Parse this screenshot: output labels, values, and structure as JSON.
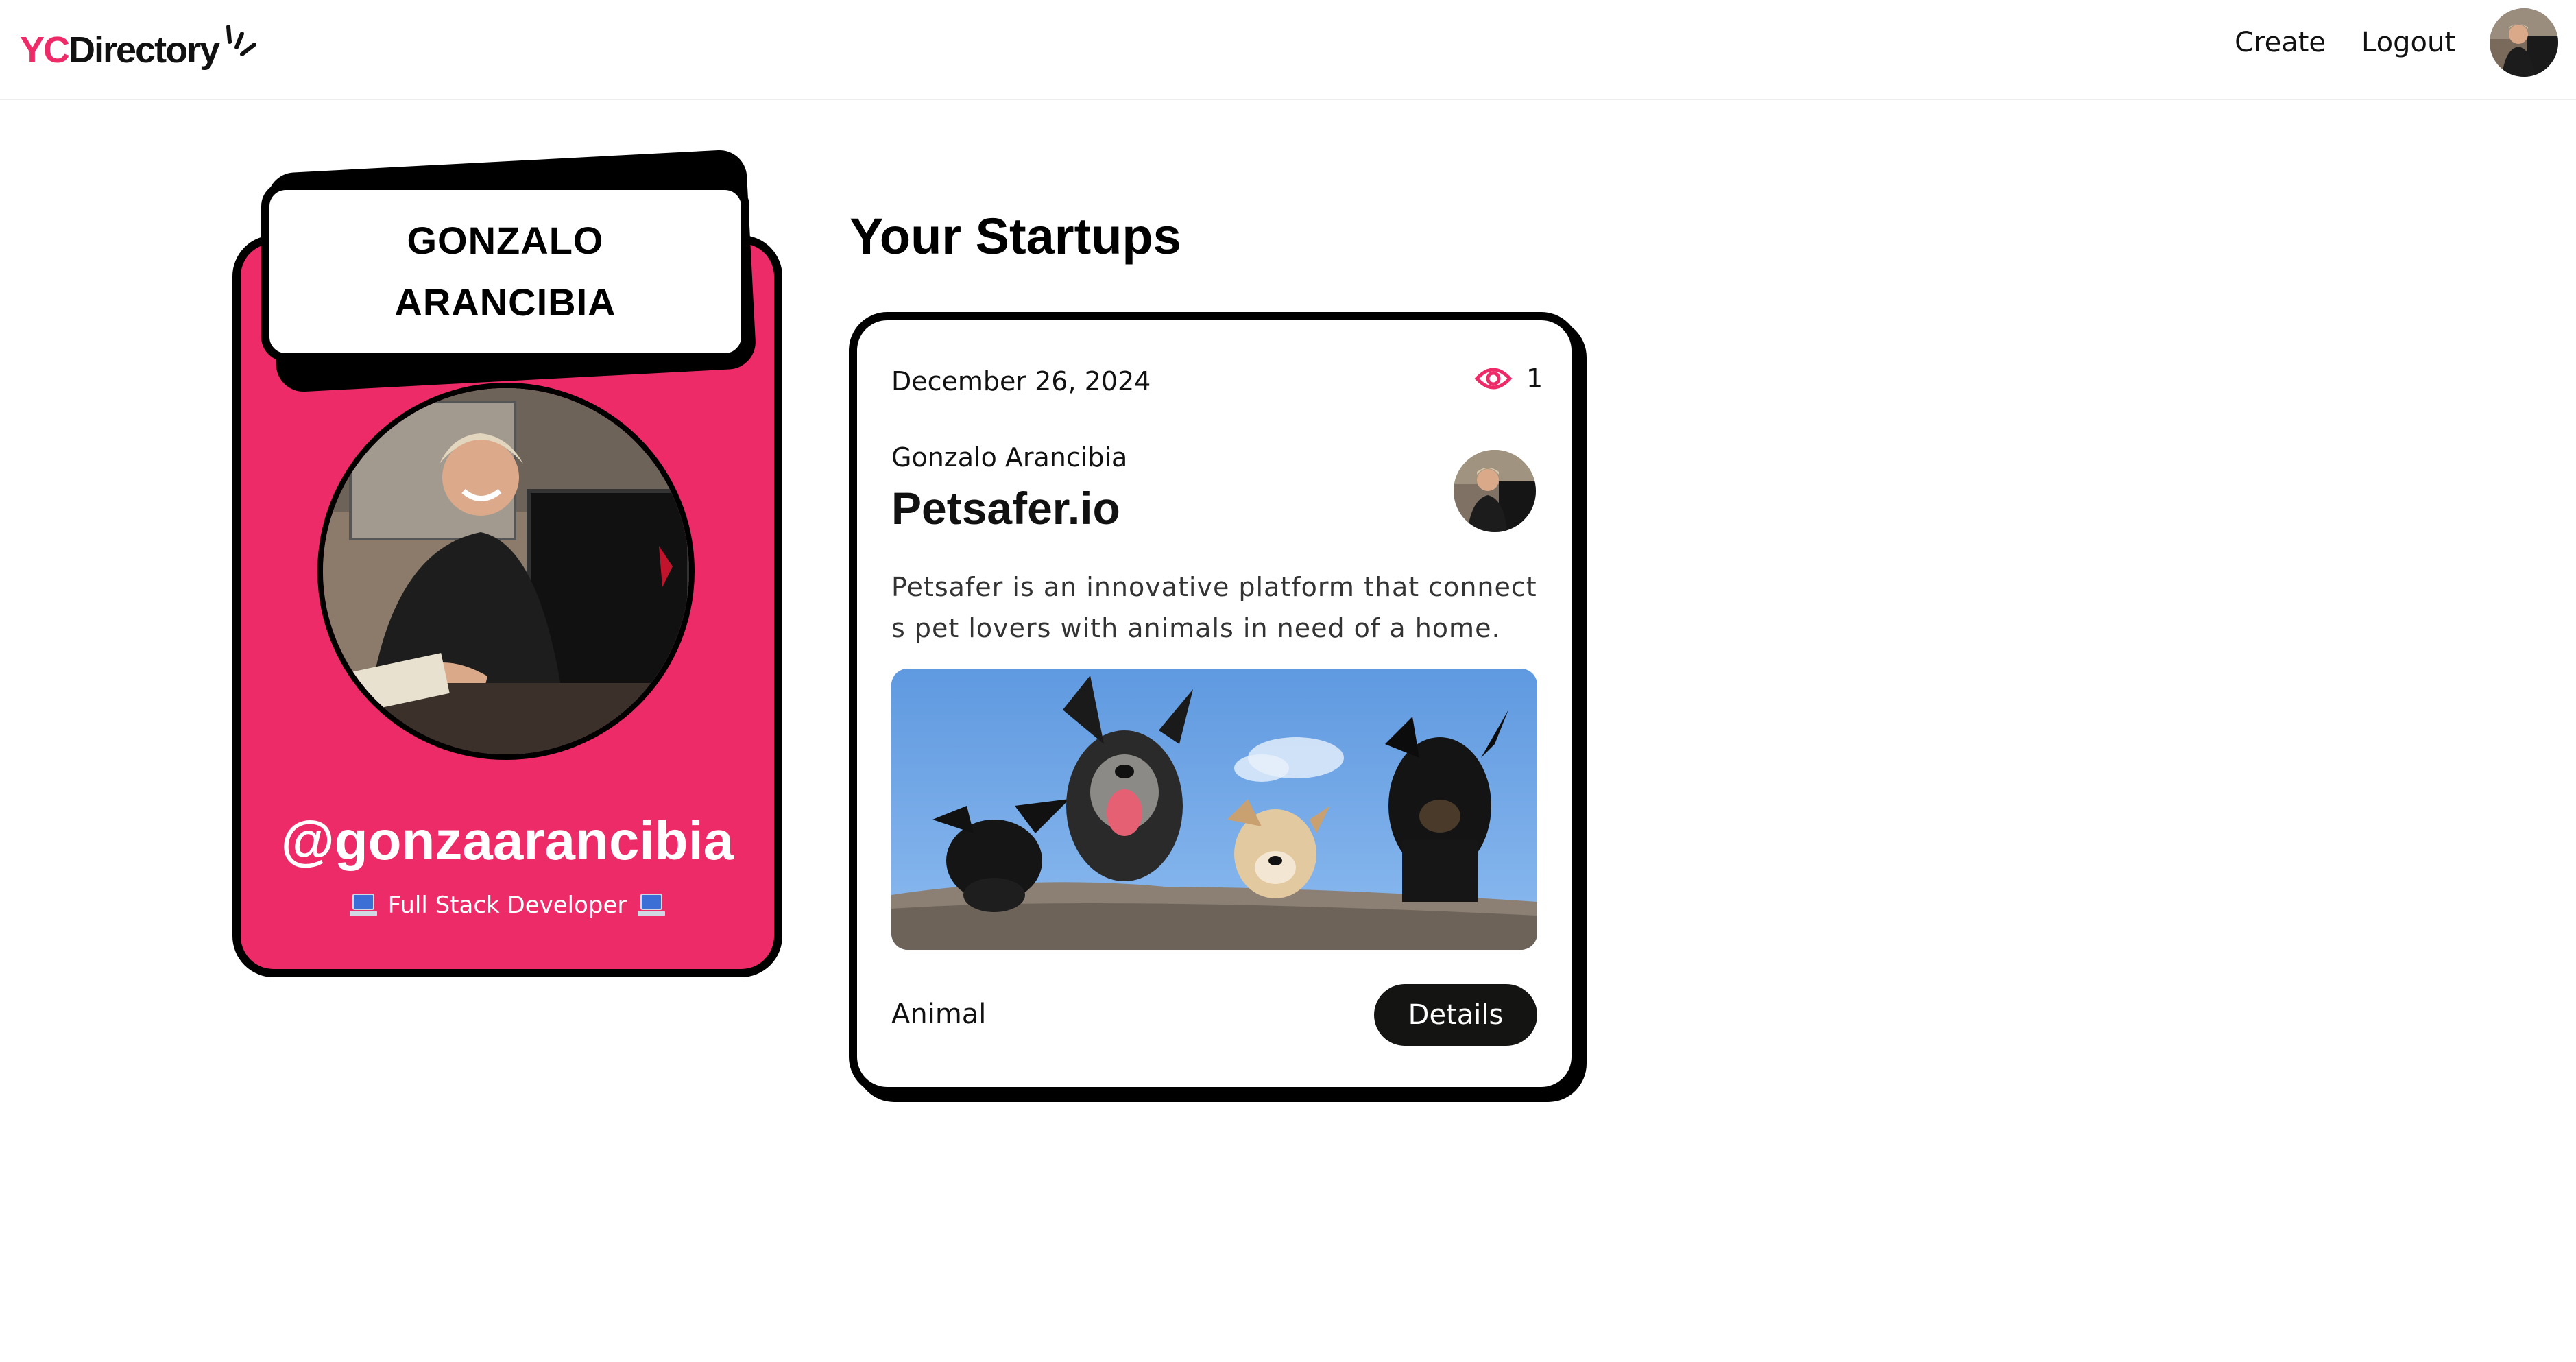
{
  "navbar": {
    "logo_yc": "YC",
    "logo_rest": "Directory",
    "create_label": "Create",
    "logout_label": "Logout",
    "avatar_icon": "user-avatar-photo"
  },
  "profile": {
    "name": "GONZALO ARANCIBIA",
    "username": "@gonzaarancibia",
    "bio": "Full Stack Developer",
    "bio_icon": "laptop-emoji",
    "accent": "#EE2B69"
  },
  "startups": {
    "section_title": "Your Startups",
    "items": [
      {
        "date": "December 26, 2024",
        "views": "1",
        "author": "Gonzalo Arancibia",
        "title": "Petsafer.io",
        "description": "Petsafer is an innovative platform that connects pet lovers with animals in need of a home. I...",
        "category": "Animal",
        "details_label": "Details"
      }
    ]
  }
}
